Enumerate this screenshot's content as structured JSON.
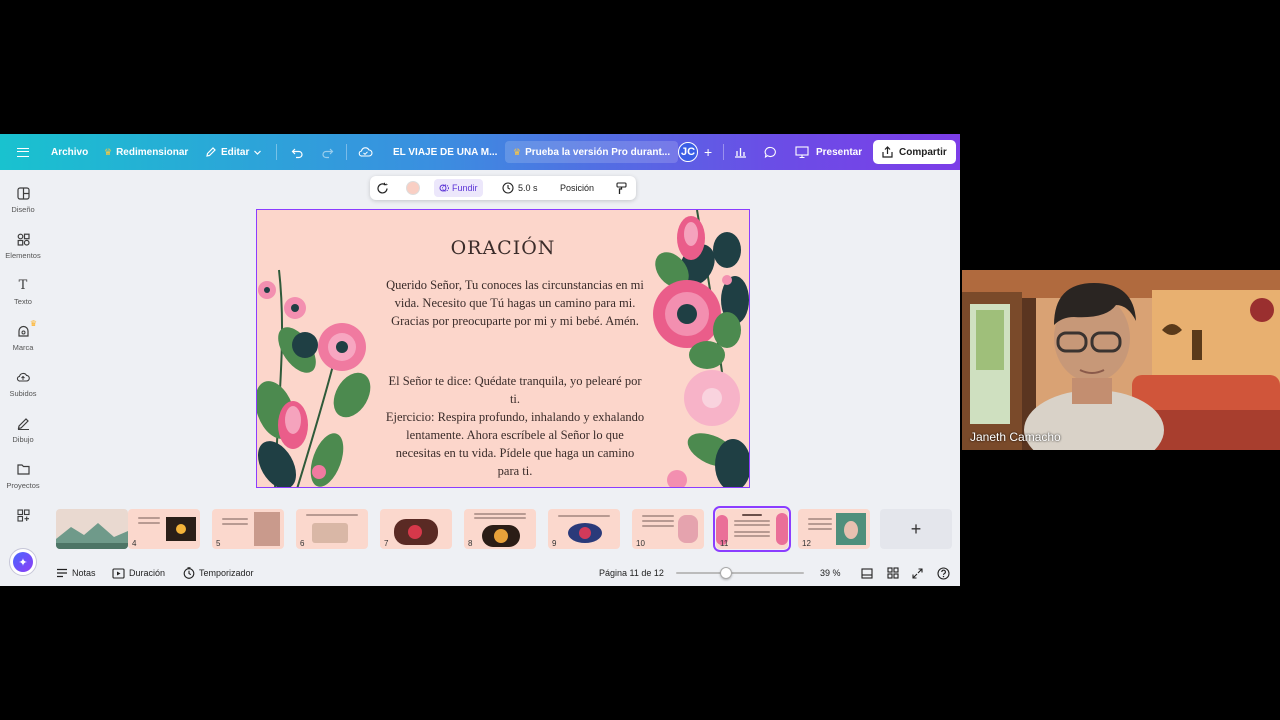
{
  "topbar": {
    "archivo": "Archivo",
    "redimensionar": "Redimensionar",
    "editar": "Editar",
    "doc_title": "EL VIAJE DE UNA M...",
    "promo": "Prueba la versión Pro durant...",
    "avatar_initials": "JC",
    "presentar": "Presentar",
    "compartir": "Compartir"
  },
  "sidebar": {
    "items": [
      {
        "label": "Diseño",
        "icon": "layout-icon"
      },
      {
        "label": "Elementos",
        "icon": "shapes-icon"
      },
      {
        "label": "Texto",
        "icon": "text-icon"
      },
      {
        "label": "Marca",
        "icon": "brand-icon"
      },
      {
        "label": "Subidos",
        "icon": "cloud-upload-icon"
      },
      {
        "label": "Dibujo",
        "icon": "pen-icon"
      },
      {
        "label": "Proyectos",
        "icon": "folder-icon"
      },
      {
        "label": "",
        "icon": "apps-icon"
      }
    ]
  },
  "floatbar": {
    "fundir": "Fundir",
    "duration": "5.0 s",
    "posicion": "Posición"
  },
  "slide": {
    "title": "ORACIÓN",
    "paragraph1": "Querido Señor, Tu conoces las circunstancias en mi vida. Necesito que Tú hagas un camino para mi. Gracias por preocuparte por mi y mi bebé. Amén.",
    "paragraph2": "El Señor te dice: Quédate tranquila, yo pelearé por ti.",
    "paragraph3": "Ejercicio: Respira profundo, inhalando y exhalando lentamente. Ahora escríbele al Señor lo que necesitas en tu vida. Pídele que haga un camino para ti."
  },
  "filmstrip": {
    "pages": [
      "",
      "4",
      "5",
      "6",
      "7",
      "8",
      "9",
      "10",
      "11",
      "12"
    ],
    "selected": "11"
  },
  "bottombar": {
    "notas": "Notas",
    "duracion": "Duración",
    "temporizador": "Temporizador",
    "page_indicator": "Página 11 de 12",
    "zoom": "39 %",
    "zoom_level_percent": 39
  },
  "video": {
    "participant_name": "Janeth Camacho"
  },
  "colors": {
    "accent": "#8b3dff",
    "slide_bg": "#fcd6cb",
    "topbar_start": "#19c2cf",
    "topbar_end": "#7c3de8"
  }
}
